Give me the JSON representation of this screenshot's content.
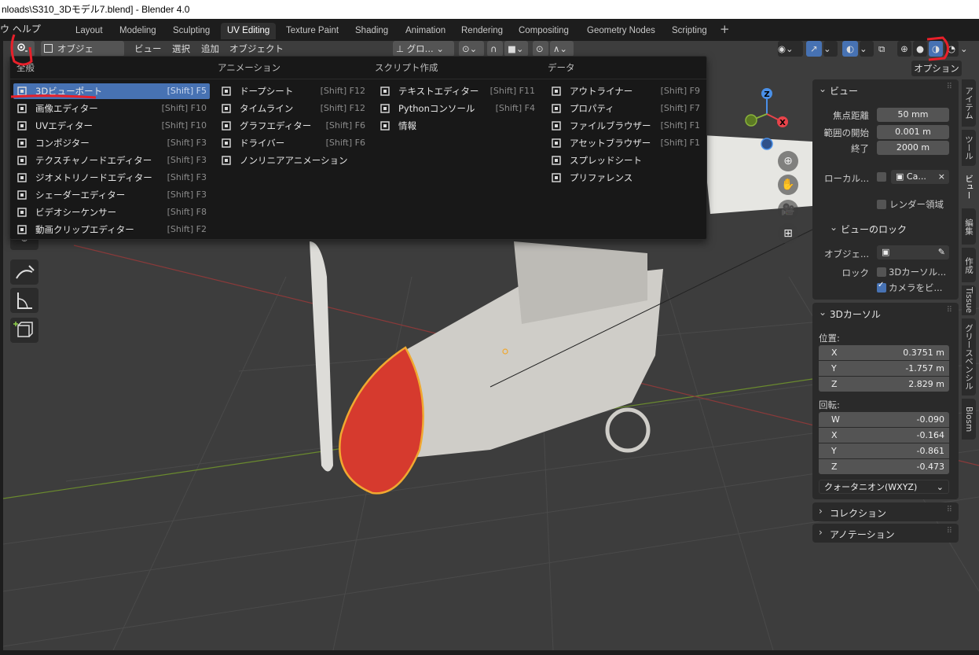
{
  "window": {
    "title": "nloads\\S310_3Dモデル7.blend] - Blender 4.0"
  },
  "topbar": {
    "menu_fragment": "ウ   ヘルプ",
    "tabs": [
      "Layout",
      "Modeling",
      "Sculpting",
      "UV Editing",
      "Texture Paint",
      "Shading",
      "Animation",
      "Rendering",
      "Compositing",
      "Geometry Nodes",
      "Scripting"
    ],
    "active_tab": "UV Editing",
    "add_label": "+"
  },
  "viewport_header": {
    "mode_label": "オブジェク...",
    "menus": [
      "ビュー",
      "選択",
      "追加",
      "オブジェクト"
    ],
    "transform_label": "グロ...",
    "options_label": "オプション"
  },
  "editor_menu": {
    "columns": [
      {
        "title": "全般",
        "items": [
          {
            "label": "3Dビューポート",
            "shortcut": "[Shift] F5",
            "icon": "3d-viewport-icon"
          },
          {
            "label": "画像エディター",
            "shortcut": "[Shift] F10",
            "icon": "image-editor-icon"
          },
          {
            "label": "UVエディター",
            "shortcut": "[Shift] F10",
            "icon": "uv-editor-icon"
          },
          {
            "label": "コンポジター",
            "shortcut": "[Shift] F3",
            "icon": "compositor-icon"
          },
          {
            "label": "テクスチャノードエディター",
            "shortcut": "[Shift] F3",
            "icon": "texture-node-icon"
          },
          {
            "label": "ジオメトリノードエディター",
            "shortcut": "[Shift] F3",
            "icon": "geometry-node-icon"
          },
          {
            "label": "シェーダーエディター",
            "shortcut": "[Shift] F3",
            "icon": "shader-editor-icon"
          },
          {
            "label": "ビデオシーケンサー",
            "shortcut": "[Shift] F8",
            "icon": "video-sequencer-icon"
          },
          {
            "label": "動画クリップエディター",
            "shortcut": "[Shift] F2",
            "icon": "movie-clip-icon"
          }
        ]
      },
      {
        "title": "アニメーション",
        "items": [
          {
            "label": "ドープシート",
            "shortcut": "[Shift] F12",
            "icon": "dopesheet-icon"
          },
          {
            "label": "タイムライン",
            "shortcut": "[Shift] F12",
            "icon": "timeline-icon"
          },
          {
            "label": "グラフエディター",
            "shortcut": "[Shift] F6",
            "icon": "graph-editor-icon"
          },
          {
            "label": "ドライバー",
            "shortcut": "[Shift] F6",
            "icon": "driver-icon"
          },
          {
            "label": "ノンリニアアニメーション",
            "shortcut": "",
            "icon": "nla-icon"
          }
        ]
      },
      {
        "title": "スクリプト作成",
        "items": [
          {
            "label": "テキストエディター",
            "shortcut": "[Shift] F11",
            "icon": "text-editor-icon"
          },
          {
            "label": "Pythonコンソール",
            "shortcut": "[Shift] F4",
            "icon": "python-console-icon"
          },
          {
            "label": "情報",
            "shortcut": "",
            "icon": "info-icon"
          }
        ]
      },
      {
        "title": "データ",
        "items": [
          {
            "label": "アウトライナー",
            "shortcut": "[Shift] F9",
            "icon": "outliner-icon"
          },
          {
            "label": "プロパティ",
            "shortcut": "[Shift] F7",
            "icon": "properties-icon"
          },
          {
            "label": "ファイルブラウザー",
            "shortcut": "[Shift] F1",
            "icon": "file-browser-icon"
          },
          {
            "label": "アセットブラウザー",
            "shortcut": "[Shift] F1",
            "icon": "asset-browser-icon"
          },
          {
            "label": "スプレッドシート",
            "shortcut": "",
            "icon": "spreadsheet-icon"
          },
          {
            "label": "プリファレンス",
            "shortcut": "",
            "icon": "preferences-icon"
          }
        ]
      }
    ]
  },
  "gizmo": {
    "z": "Z",
    "x": "X"
  },
  "sidebar": {
    "view_panel": {
      "title": "ビュー",
      "focal_label": "焦点距離",
      "focal_value": "50 mm",
      "clip_start_label": "範囲の開始",
      "clip_start_value": "0.001 m",
      "clip_end_label": "終了",
      "clip_end_value": "2000 m",
      "local_label": "ローカル...",
      "local_value": "Ca...",
      "render_region_label": "レンダー領域",
      "lock_title": "ビューのロック",
      "lock_object_label": "オブジェ...",
      "lock_label": "ロック",
      "lock_cursor_label": "3Dカーソル...",
      "lock_camera_label": "カメラをビ..."
    },
    "cursor_panel": {
      "title": "3Dカーソル",
      "location_label": "位置:",
      "location": [
        {
          "axis": "X",
          "value": "0.3751 m"
        },
        {
          "axis": "Y",
          "value": "-1.757 m"
        },
        {
          "axis": "Z",
          "value": "2.829 m"
        }
      ],
      "rotation_label": "回転:",
      "rotation": [
        {
          "axis": "W",
          "value": "-0.090"
        },
        {
          "axis": "X",
          "value": "-0.164"
        },
        {
          "axis": "Y",
          "value": "-0.861"
        },
        {
          "axis": "Z",
          "value": "-0.473"
        }
      ],
      "rotation_mode": "クォータニオン(WXYZ)"
    },
    "collapsed_panels": [
      "コレクション",
      "アノテーション"
    ],
    "tabs": [
      "アイテム",
      "ツール",
      "ビュー",
      "編集",
      "作成",
      "Tissue",
      "グリースペンシル",
      "Blosm"
    ],
    "active_tab": "ビュー"
  },
  "colors": {
    "accent": "#4772b3",
    "nose_cone": "#d63a2e",
    "annotation": "#e8202a"
  }
}
